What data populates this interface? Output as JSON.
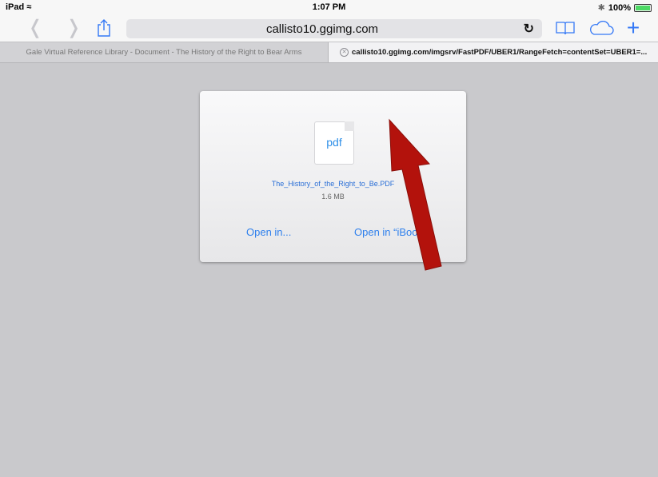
{
  "status_bar": {
    "device": "iPad",
    "time": "1:07 PM",
    "battery_pct": "100%",
    "wifi_icon": "wifi-icon",
    "bluetooth_icon": "bluetooth-icon"
  },
  "toolbar": {
    "back_icon": "chevron-left-icon",
    "forward_icon": "chevron-right-icon",
    "share_icon": "share-icon",
    "url": "callisto10.ggimg.com",
    "reload_icon": "reload-icon",
    "bookmarks_icon": "book-icon",
    "icloud_icon": "cloud-icon",
    "new_tab_icon": "plus-icon"
  },
  "tabs": [
    {
      "label": "Gale Virtual Reference Library - Document - The History of the Right to Bear Arms",
      "active": false
    },
    {
      "label": "callisto10.ggimg.com/imgsrv/FastPDF/UBER1/RangeFetch=contentSet=UBER1=...",
      "active": true
    }
  ],
  "dialog": {
    "icon_text": "pdf",
    "filename": "The_History_of_the_Right_to_Be.PDF",
    "filesize": "1.6 MB",
    "open_in_label": "Open in...",
    "open_ibooks_label": "Open in “iBooks”"
  },
  "colors": {
    "accent": "#3478f6",
    "arrow": "#b3120c",
    "background": "#c9c9cc"
  }
}
